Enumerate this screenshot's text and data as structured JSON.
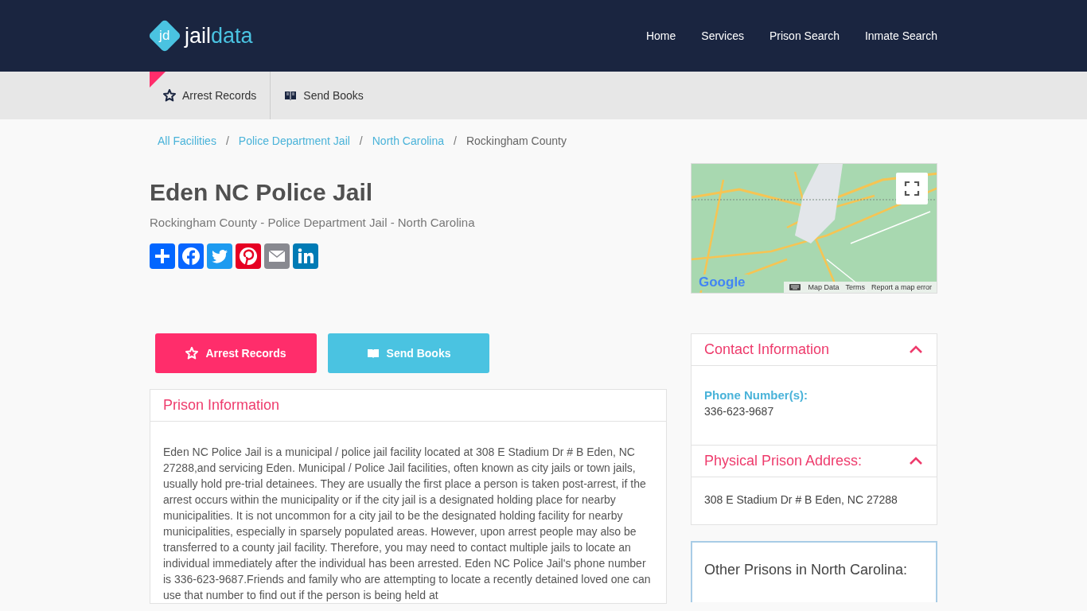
{
  "header": {
    "logo_mark": "jd",
    "logo_word_1": "jail",
    "logo_word_2": "data",
    "nav": [
      {
        "label": "Home"
      },
      {
        "label": "Services"
      },
      {
        "label": "Prison Search"
      },
      {
        "label": "Inmate Search"
      }
    ]
  },
  "subnav": [
    {
      "label": "Arrest Records",
      "kind": "star",
      "selected": true
    },
    {
      "label": "Send Books",
      "kind": "book",
      "selected": false
    }
  ],
  "breadcrumbs": [
    {
      "label": "All Facilities",
      "link": true,
      "separator": "/"
    },
    {
      "label": "Police Department Jail",
      "link": true,
      "separator": "/"
    },
    {
      "label": "North Carolina",
      "link": true,
      "separator": "/"
    },
    {
      "label": "Rockingham County",
      "link": false
    }
  ],
  "title": "Eden NC Police Jail",
  "subtitle": "Rockingham County - Police Department Jail - North Carolina",
  "share": [
    {
      "kind": "plus",
      "color": "#0166ff"
    },
    {
      "kind": "facebook",
      "color": "#0866ff"
    },
    {
      "kind": "twitter",
      "color": "#1d9bf0"
    },
    {
      "kind": "pinterest",
      "color": "#e60023"
    },
    {
      "kind": "email",
      "color": "#888990"
    },
    {
      "kind": "linkedin",
      "color": "#007bb5"
    }
  ],
  "map": {
    "logo": "Google",
    "links": [
      "Map Data",
      "Terms",
      "Report a map error"
    ]
  },
  "actions": [
    {
      "label": "Arrest Records",
      "kind": "star",
      "color": "#ff2d6b"
    },
    {
      "label": "Send Books",
      "kind": "book",
      "color": "#4ac3e1"
    }
  ],
  "prison_info": {
    "heading": "Prison Information",
    "text": "Eden NC Police Jail is a municipal / police jail facility located at 308 E Stadium Dr # B Eden, NC 27288,and servicing Eden. Municipal / Police Jail facilities, often known as city jails or town jails, usually hold pre-trial detainees. They are usually the first place a person is taken post-arrest, if the arrest occurs within the municipality or if the city jail is a designated holding place for nearby municipalities. It is not uncommon for a city jail to be the designated holding facility for nearby municipalities, especially in sparsely populated areas. However, upon arrest people may also be transferred to a county jail facility. Therefore, you may need to contact multiple jails to locate an individual immediately after the individual has been arrested. Eden NC Police Jail's phone number is 336-623-9687.Friends and family who are attempting to locate a recently detained loved one can use that number to find out if the person is being held at"
  },
  "contact": [
    {
      "heading": "Contact Information",
      "expanded": true,
      "label": "Phone Number(s):",
      "value": "336-623-9687"
    },
    {
      "heading": "Physical Prison Address:",
      "expanded": true,
      "value": "308 E Stadium Dr # B Eden, NC 27288"
    }
  ],
  "other_prisons": {
    "heading": "Other Prisons in North Carolina:"
  }
}
